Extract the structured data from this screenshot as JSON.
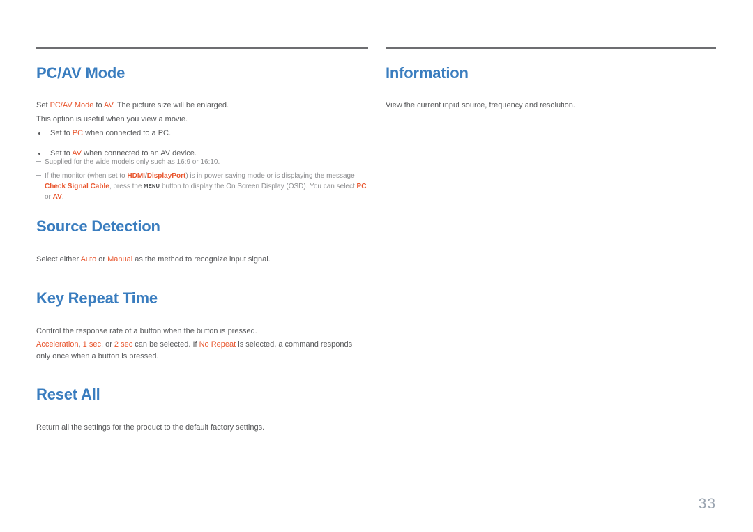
{
  "page": {
    "number": "33",
    "colors": {
      "heading": "#3a7dbf",
      "accent": "#e8552d",
      "body": "#58595b",
      "note": "#8c8d8f",
      "rule": "#6d6e71",
      "page_number": "#9aa4b0"
    }
  },
  "left_column": {
    "sections": [
      {
        "id": "pc-av-mode",
        "title": "PC/AV Mode",
        "paragraphs": [
          "Set PC/AV Mode to AV. The picture size will be enlarged.",
          "This option is useful when you view a movie."
        ],
        "bullets": [
          "Set to PC when connected to a PC.",
          "Set to AV when connected to an AV device."
        ],
        "notes": [
          "Supplied for the wide models only such as 16:9 or 16:10.",
          "If the monitor (when set to HDMI/DisplayPort) is in power saving mode or is displaying the message Check Signal Cable, press the MENU button to display the On Screen Display (OSD). You can select PC or AV."
        ],
        "inline_terms": {
          "p1_term1": "PC/AV Mode",
          "p1_term2": "AV",
          "b1_term": "PC",
          "b2_term": "AV",
          "note2_term1": "HDMI",
          "note2_term2": "DisplayPort",
          "note2_term3": "Check Signal Cable",
          "note2_key": "MENU",
          "note2_term4": "PC",
          "note2_term5": "AV"
        },
        "fragments": {
          "p1_a": "Set ",
          "p1_b": " to ",
          "p1_c": ". The picture size will be enlarged.",
          "b1_a": "Set to ",
          "b1_b": " when connected to a PC.",
          "b2_a": "Set to ",
          "b2_b": " when connected to an AV device.",
          "n2_a": "If the monitor (when set to ",
          "n2_slash": "/",
          "n2_b": ") is in power saving mode or is displaying the message ",
          "n2_c": ", press the ",
          "n2_d": " button to display the On Screen Display (OSD). You can select ",
          "n2_e": " or ",
          "n2_f": "."
        }
      },
      {
        "id": "source-detection",
        "title": "Source Detection",
        "paragraphs": [
          "Select either Auto or Manual as the method to recognize input signal."
        ],
        "inline_terms": {
          "term1": "Auto",
          "term2": "Manual"
        },
        "fragments": {
          "a": "Select either ",
          "b": " or ",
          "c": " as the method to recognize input signal."
        }
      },
      {
        "id": "key-repeat-time",
        "title": "Key Repeat Time",
        "paragraphs": [
          "Control the response rate of a button when the button is pressed.",
          "Acceleration, 1 sec, or 2 sec can be selected. If No Repeat is selected, a command responds only once when a button is pressed."
        ],
        "inline_terms": {
          "term1": "Acceleration",
          "term2": "1 sec",
          "term3": "2 sec",
          "term4": "No Repeat"
        },
        "fragments": {
          "a": ", ",
          "b": ", or ",
          "c": " can be selected. If ",
          "d": " is selected, a command responds only once when a button is pressed."
        }
      },
      {
        "id": "reset-all",
        "title": "Reset All",
        "paragraphs": [
          "Return all the settings for the product to the default factory settings."
        ]
      }
    ]
  },
  "right_column": {
    "sections": [
      {
        "id": "information",
        "title": "Information",
        "paragraphs": [
          "View the current input source, frequency and resolution."
        ]
      }
    ]
  }
}
